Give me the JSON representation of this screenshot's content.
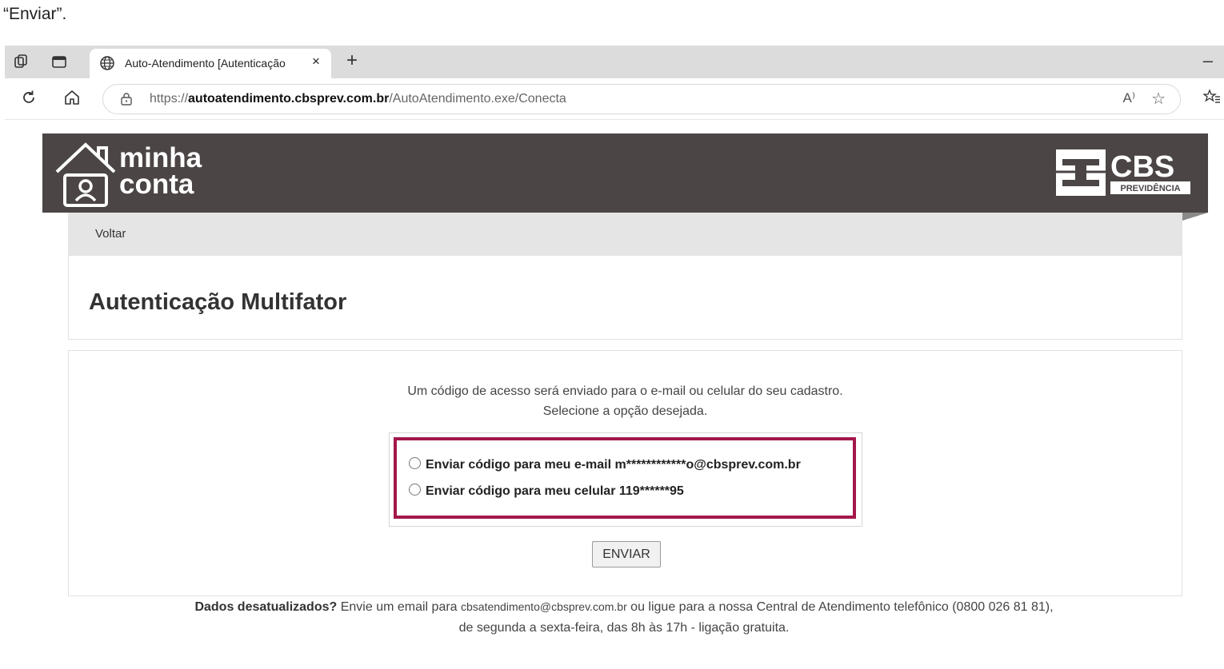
{
  "doc_fragment": "“Enviar”.",
  "browser": {
    "tab_title": "Auto-Atendimento [Autenticação",
    "tab_close": "×",
    "new_tab": "+",
    "minimize": "–",
    "url_scheme": "https://",
    "url_domain": "autoatendimento.cbsprev.com.br",
    "url_path": "/AutoAtendimento.exe/Conecta",
    "read_aloud": "A⁾"
  },
  "header": {
    "logo_line1": "minha",
    "logo_line2": "conta",
    "brand_name": "CBS",
    "brand_sub": "PREVIDÊNCIA",
    "header_color": "#4b4545"
  },
  "nav": {
    "back_label": "Voltar"
  },
  "main": {
    "title": "Autenticação Multifator",
    "intro_line1": "Um código de acesso será enviado para o e-mail ou celular do seu cadastro.",
    "intro_line2": "Selecione a opção desejada.",
    "options": [
      {
        "label": "Enviar código para meu e-mail m************o@cbsprev.com.br",
        "selected": false
      },
      {
        "label": "Enviar código para meu celular 119******95",
        "selected": false
      }
    ],
    "highlight_color": "#a3174b",
    "submit_label": "ENVIAR"
  },
  "footer": {
    "bold_question": "Dados desatualizados?",
    "text_before_email": " Envie um email para ",
    "email": "cbsatendimento@cbsprev.com.br",
    "text_after_email": " ou ligue para a nossa Central de Atendimento telefônico (0800 026 81 81),",
    "line2": "de segunda a sexta-feira, das 8h às 17h - ligação gratuita."
  }
}
